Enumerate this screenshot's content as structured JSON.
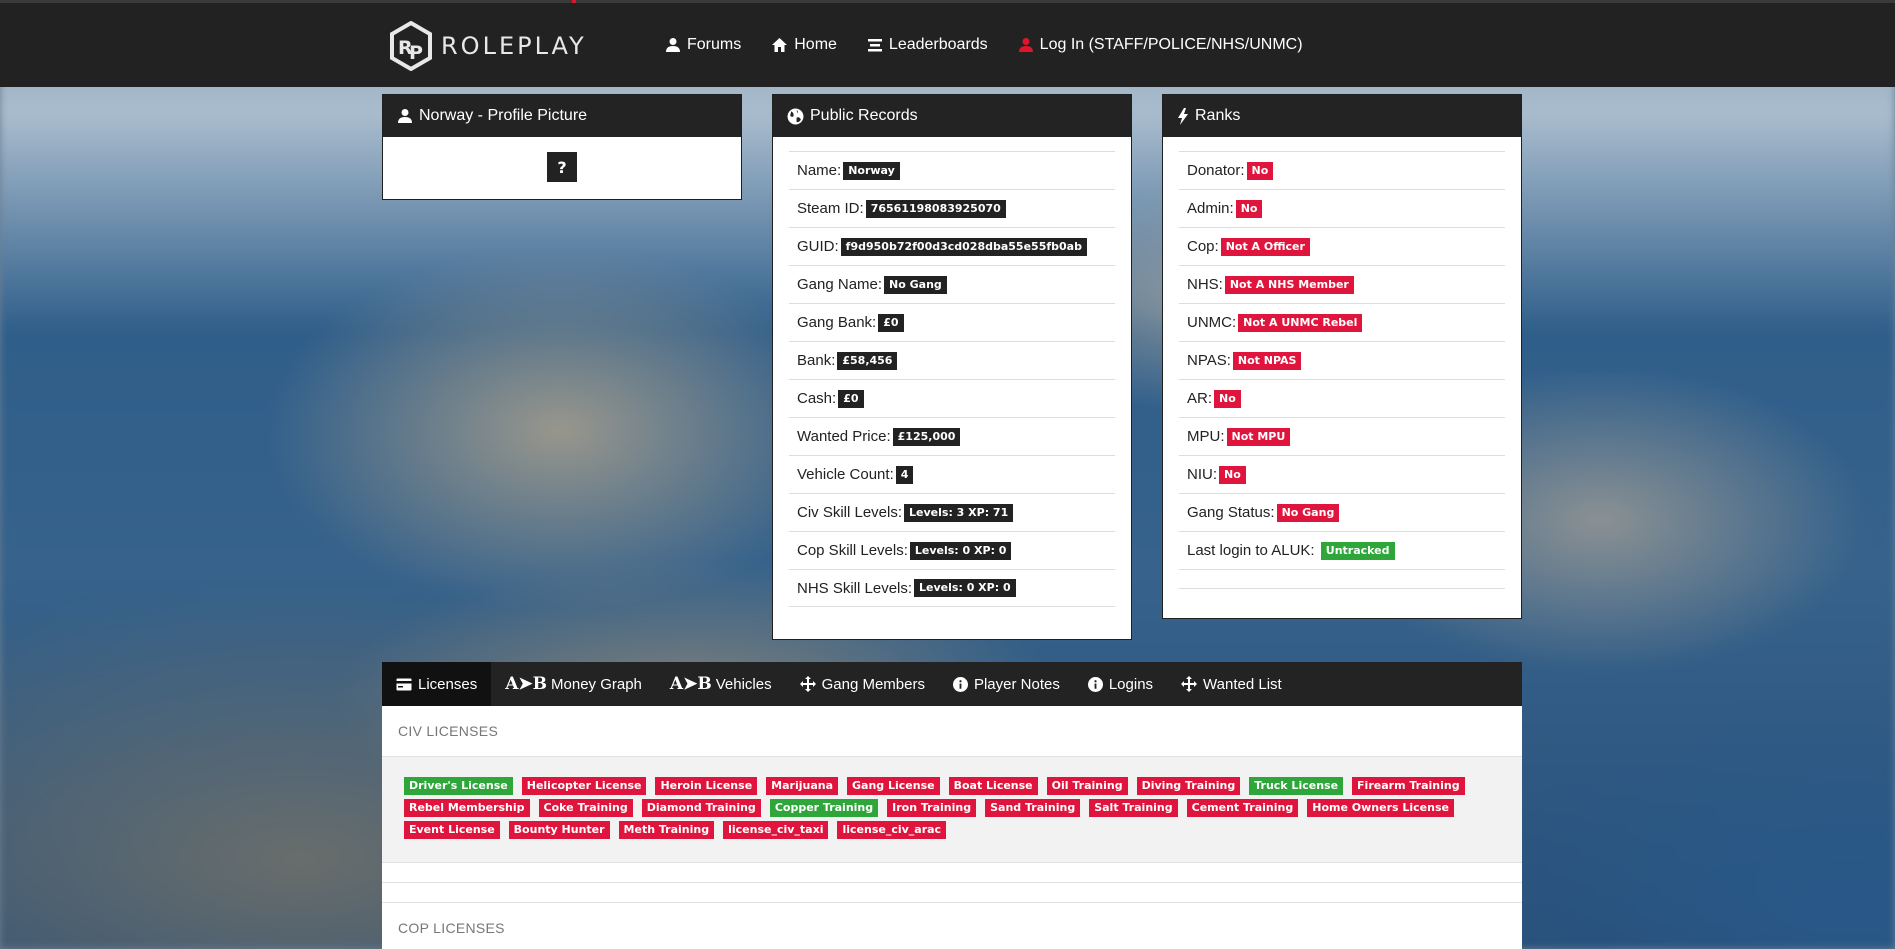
{
  "nav": {
    "brand": "ROLEPLAY",
    "items": [
      {
        "label": "Forums",
        "icon": "user-icon"
      },
      {
        "label": "Home",
        "icon": "home-icon"
      },
      {
        "label": "Leaderboards",
        "icon": "list-icon"
      },
      {
        "label": "Log In (STAFF/POLICE/NHS/UNMC)",
        "icon": "user-icon-red"
      }
    ]
  },
  "profile": {
    "title": "Norway - Profile Picture",
    "placeholder": "?"
  },
  "records": {
    "title": "Public Records",
    "rows": [
      {
        "label": "Name:",
        "value": "Norway"
      },
      {
        "label": "Steam ID:",
        "value": "76561198083925070"
      },
      {
        "label": "GUID:",
        "value": "f9d950b72f00d3cd028dba55e55fb0ab"
      },
      {
        "label": "Gang Name:",
        "value": "No Gang"
      },
      {
        "label": "Gang Bank:",
        "value": "£0"
      },
      {
        "label": "Bank:",
        "value": "£58,456"
      },
      {
        "label": "Cash:",
        "value": "£0"
      },
      {
        "label": "Wanted Price:",
        "value": "£125,000"
      },
      {
        "label": "Vehicle Count:",
        "value": "4"
      },
      {
        "label": "Civ Skill Levels:",
        "value": "Levels: 3 XP: 71"
      },
      {
        "label": "Cop Skill Levels:",
        "value": "Levels: 0 XP: 0"
      },
      {
        "label": "NHS Skill Levels:",
        "value": "Levels: 0 XP: 0"
      }
    ]
  },
  "ranks": {
    "title": "Ranks",
    "rows": [
      {
        "label": "Donator:",
        "value": "No",
        "color": "red"
      },
      {
        "label": "Admin:",
        "value": "No",
        "color": "red"
      },
      {
        "label": "Cop:",
        "value": "Not A Officer",
        "color": "red"
      },
      {
        "label": "NHS:",
        "value": "Not A NHS Member",
        "color": "red"
      },
      {
        "label": "UNMC:",
        "value": "Not A UNMC Rebel",
        "color": "red"
      },
      {
        "label": "NPAS:",
        "value": "Not NPAS",
        "color": "red"
      },
      {
        "label": "AR:",
        "value": "No",
        "color": "red"
      },
      {
        "label": "MPU:",
        "value": "Not MPU",
        "color": "red"
      },
      {
        "label": "NIU:",
        "value": "No",
        "color": "red"
      },
      {
        "label": "Gang Status:",
        "value": "No Gang",
        "color": "red"
      },
      {
        "label": "Last login to ALUK:",
        "value": "Untracked",
        "color": "green"
      }
    ]
  },
  "tabs": {
    "items": [
      {
        "label": "Licenses",
        "icon": "card-icon",
        "active": true
      },
      {
        "label": "Money Graph",
        "icon": "ab-icon"
      },
      {
        "label": "Vehicles",
        "icon": "ab-icon"
      },
      {
        "label": "Gang Members",
        "icon": "move-icon"
      },
      {
        "label": "Player Notes",
        "icon": "info-icon"
      },
      {
        "label": "Logins",
        "icon": "info-icon"
      },
      {
        "label": "Wanted List",
        "icon": "move-icon"
      }
    ],
    "ab_glyph": "A➤B"
  },
  "licenses": {
    "civ_title": "CIV LICENSES",
    "cop_title": "COP LICENSES",
    "colors": {
      "red": "#e0153d",
      "green": "#2ea63a"
    },
    "civ_lines": [
      [
        {
          "label": "Driver's License",
          "color": "green"
        },
        {
          "label": "Helicopter License",
          "color": "red"
        },
        {
          "label": "Heroin License",
          "color": "red"
        },
        {
          "label": "Marijuana",
          "color": "red"
        },
        {
          "label": "Gang License",
          "color": "red"
        },
        {
          "label": "Boat License",
          "color": "red"
        },
        {
          "label": "Oil Training",
          "color": "red"
        },
        {
          "label": "Diving Training",
          "color": "red"
        },
        {
          "label": "Truck License",
          "color": "green"
        },
        {
          "label": "Firearm Training",
          "color": "red"
        }
      ],
      [
        {
          "label": "Rebel Membership",
          "color": "red"
        },
        {
          "label": "Coke Training",
          "color": "red"
        },
        {
          "label": "Diamond Training",
          "color": "red"
        },
        {
          "label": "Copper Training",
          "color": "green"
        },
        {
          "label": "Iron Training",
          "color": "red"
        },
        {
          "label": "Sand Training",
          "color": "red"
        },
        {
          "label": "Salt Training",
          "color": "red"
        },
        {
          "label": "Cement Training",
          "color": "red"
        },
        {
          "label": "Home Owners License",
          "color": "red"
        }
      ],
      [
        {
          "label": "Event License",
          "color": "red"
        },
        {
          "label": "Bounty Hunter",
          "color": "red"
        },
        {
          "label": "Meth Training",
          "color": "red"
        },
        {
          "label": "license_civ_taxi",
          "color": "red"
        },
        {
          "label": "license_civ_arac",
          "color": "red"
        }
      ]
    ]
  }
}
